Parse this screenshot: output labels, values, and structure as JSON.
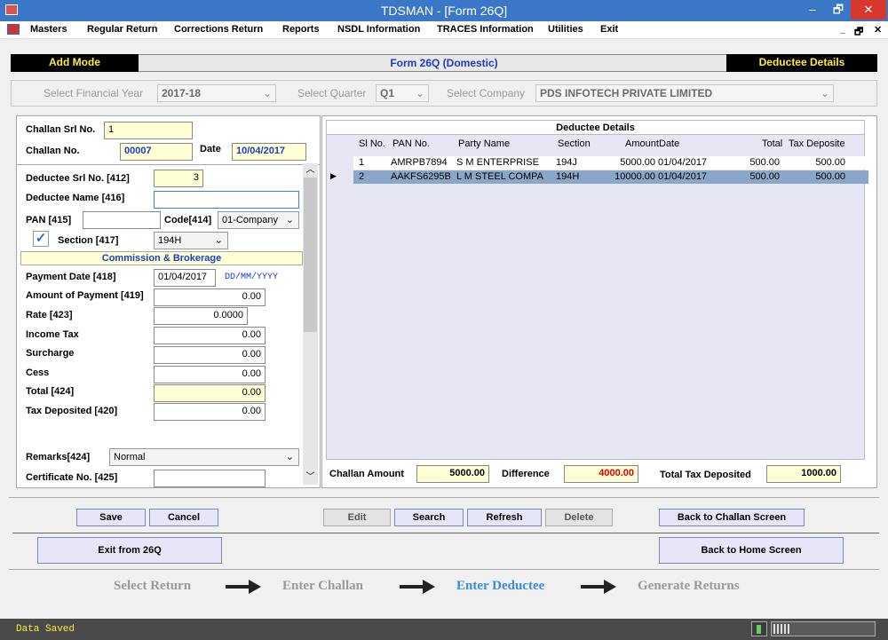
{
  "window": {
    "title": "TDSMAN - [Form 26Q]",
    "min": "–",
    "restore": "🗗",
    "close": "✕"
  },
  "menu": [
    "Masters",
    "Regular Return",
    "Corrections Return",
    "Reports",
    "NSDL Information",
    "TRACES Information",
    "Utilities",
    "Exit"
  ],
  "menu_right": {
    "min": "_",
    "restore": "🗗",
    "close": "✕"
  },
  "mode": {
    "left": "Add Mode",
    "center": "Form 26Q (Domestic)",
    "right": "Deductee Details"
  },
  "selectors": {
    "fy_label": "Select Financial Year",
    "fy_value": "2017-18",
    "q_label": "Select Quarter",
    "q_value": "Q1",
    "co_label": "Select Company",
    "co_value": "PDS INFOTECH PRIVATE LIMITED"
  },
  "left": {
    "challan_srl_label": "Challan Srl No.",
    "challan_srl": "1",
    "challan_no_label": "Challan No.",
    "challan_no": "00007",
    "date_label": "Date",
    "date": "10/04/2017",
    "deductee_srl_label": "Deductee Srl No. [412]",
    "deductee_srl": "3",
    "deductee_name_label": "Deductee Name [416]",
    "deductee_name": "",
    "pan_label": "PAN [415]",
    "pan": "",
    "code_label": "Code[414]",
    "code": "01-Company",
    "section_label": "Section [417]",
    "section": "194H",
    "section_header": "Commission & Brokerage",
    "payment_date_label": "Payment Date [418]",
    "payment_date": "01/04/2017",
    "date_hint": "DD/MM/YYYY",
    "amount_label": "Amount of Payment [419]",
    "amount": "0.00",
    "rate_label": "Rate [423]",
    "rate": "0.0000",
    "income_tax_label": "Income Tax",
    "income_tax": "0.00",
    "surcharge_label": "Surcharge",
    "surcharge": "0.00",
    "cess_label": "Cess",
    "cess": "0.00",
    "total_label": "Total [424]",
    "total": "0.00",
    "tax_dep_label": "Tax Deposited [420]",
    "tax_dep": "0.00",
    "remarks_label": "Remarks[424]",
    "remarks": "Normal",
    "cert_label": "Certificate No. [425]",
    "cert": ""
  },
  "grid": {
    "title": "Deductee  Details",
    "columns": [
      "Sl No.",
      "PAN No.",
      "Party Name",
      "Section",
      "Amount",
      "Date",
      "Total",
      "Tax Deposite"
    ],
    "rows": [
      {
        "sl": "1",
        "pan": "AMRPB7894",
        "party": "S M ENTERPRISE",
        "section": "194J",
        "amount": "5000.00",
        "date": "01/04/2017",
        "total": "500.00",
        "tax": "500.00"
      },
      {
        "sl": "2",
        "pan": "AAKFS6295B",
        "party": "L M STEEL COMPA",
        "section": "194H",
        "amount": "10000.00",
        "date": "01/04/2017",
        "total": "500.00",
        "tax": "500.00"
      }
    ]
  },
  "totals": {
    "challan_amount_label": "Challan Amount",
    "challan_amount": "5000.00",
    "difference_label": "Difference",
    "difference": "4000.00",
    "total_tax_label": "Total Tax Deposited",
    "total_tax": "1000.00"
  },
  "buttons": {
    "save": "Save",
    "cancel": "Cancel",
    "edit": "Edit",
    "search": "Search",
    "refresh": "Refresh",
    "delete": "Delete",
    "back_challan": "Back to Challan Screen",
    "exit26q": "Exit from 26Q",
    "back_home": "Back to Home Screen"
  },
  "steps": [
    "Select Return",
    "Enter Challan",
    "Enter Deductee",
    "Generate Returns"
  ],
  "status": "Data Saved",
  "colors": {
    "titlebar": "#3a78c7",
    "accent_blue": "#1a3cc8",
    "difference_red": "#e00000",
    "current_step": "#3a8bd8"
  }
}
